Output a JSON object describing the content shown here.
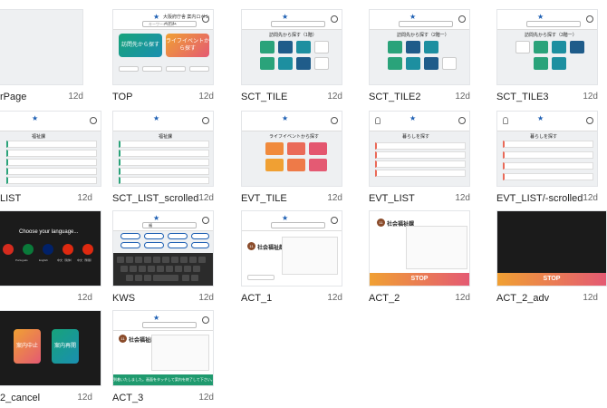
{
  "header": {
    "app_title": "大阪府庁舎 案内ロボシステム",
    "search_placeholder": "キーワード検索",
    "star_icon": "star-icon",
    "lang_icon": "globe-icon"
  },
  "cards": [
    {
      "name": "rPage",
      "age": "12d"
    },
    {
      "name": "TOP",
      "age": "12d"
    },
    {
      "name": "SCT_TILE",
      "age": "12d"
    },
    {
      "name": "SCT_TILE2",
      "age": "12d"
    },
    {
      "name": "SCT_TILE3",
      "age": "12d"
    },
    {
      "name": "LIST",
      "age": "12d"
    },
    {
      "name": "SCT_LIST_scrolled",
      "age": "12d"
    },
    {
      "name": "EVT_TILE",
      "age": "12d"
    },
    {
      "name": "EVT_LIST",
      "age": "12d"
    },
    {
      "name": "EVT_LIST/-scrolled",
      "age": "12d"
    },
    {
      "name": "",
      "age": "12d"
    },
    {
      "name": "KWS",
      "age": "12d"
    },
    {
      "name": "ACT_1",
      "age": "12d"
    },
    {
      "name": "ACT_2",
      "age": "12d"
    },
    {
      "name": "ACT_2_adv",
      "age": "12d"
    },
    {
      "name": "2_cancel",
      "age": "12d"
    },
    {
      "name": "ACT_3",
      "age": "12d"
    }
  ],
  "thumbs": {
    "top_left_btn": "訪問先から探す",
    "top_right_btn": "ライフイベントから探す",
    "sct_title": "訪問先から探す（1階）",
    "sct_title2": "訪問先から探す（2階ー）",
    "sct_title3": "訪問先から探す（3階ー）",
    "list_title": "福祉課",
    "evt_title": "ライフイベントから探す",
    "evt_list_title": "暮らしを探す",
    "lang_title": "Choose your language...",
    "lang_labels": [
      "Português",
      "English",
      "中文（简体）",
      "中文（繁體）"
    ],
    "kws_text": "福",
    "act_title": "社会福祉課",
    "act_badge": "11",
    "stop_label": "STOP",
    "act3_banner": "到着いたしました。画面をタッチして案内を終了して下さい。",
    "cancel_left": "案内中止",
    "cancel_right": "案内再開"
  }
}
